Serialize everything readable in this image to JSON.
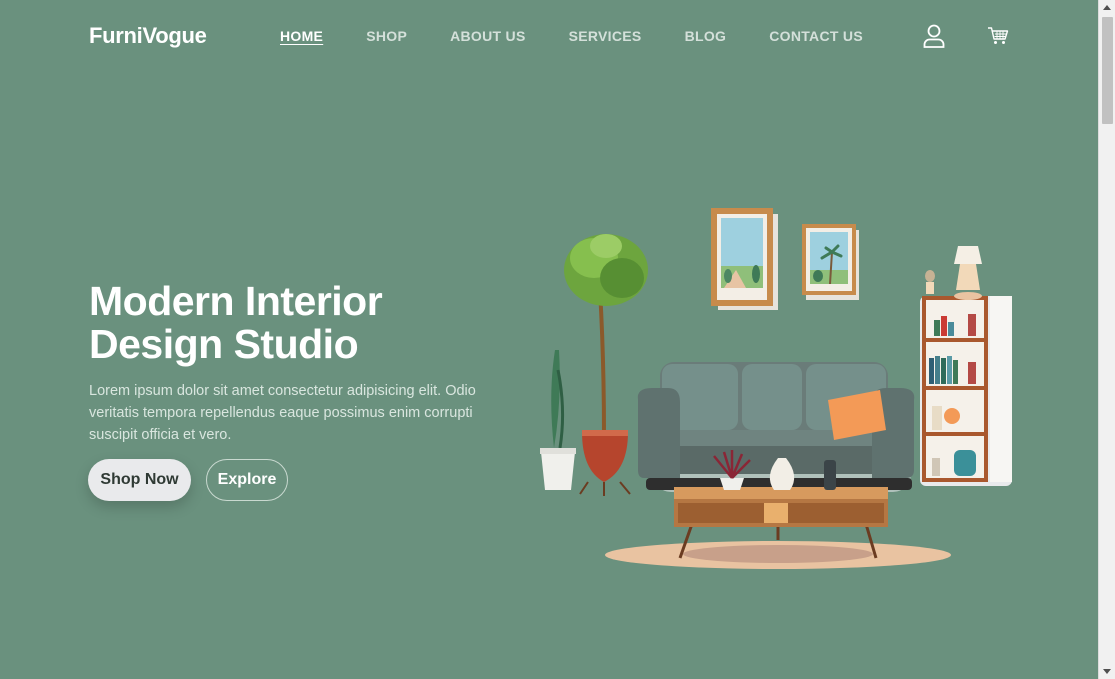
{
  "brand": "FurniVogue",
  "nav": {
    "items": [
      {
        "label": "HOME",
        "active": true
      },
      {
        "label": "SHOP",
        "active": false
      },
      {
        "label": "ABOUT US",
        "active": false
      },
      {
        "label": "SERVICES",
        "active": false
      },
      {
        "label": "BLOG",
        "active": false
      },
      {
        "label": "CONTACT US",
        "active": false
      }
    ],
    "icons": [
      "user-icon",
      "cart-icon"
    ]
  },
  "hero": {
    "title_line1": "Modern Interior",
    "title_line2": "Design Studio",
    "description": "Lorem ipsum dolor sit amet consectetur adipisicing elit. Odio veritatis tempora repellendus eaque possimus enim corrupti suscipit officia et vero.",
    "primary_button": "Shop Now",
    "secondary_button": "Explore"
  },
  "colors": {
    "background": "#6a917e",
    "sofa": "#5f6e6c",
    "cushion": "#f39a57",
    "table": "#b57743",
    "rug": "#e9c3a1"
  }
}
